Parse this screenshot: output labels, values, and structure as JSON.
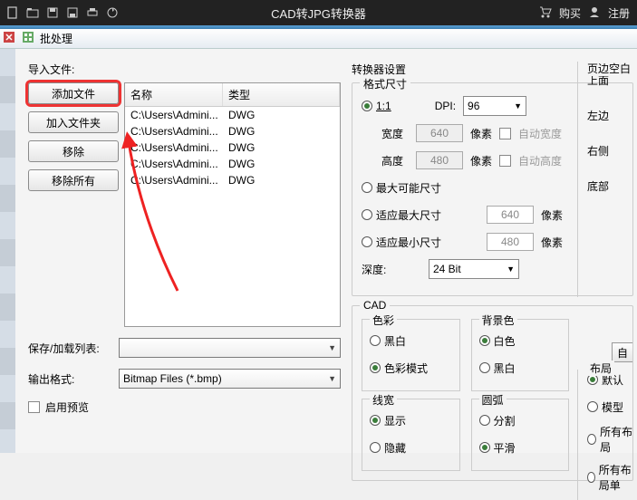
{
  "titlebar": {
    "title": "CAD转JPG转换器",
    "buy": "购买",
    "register": "注册"
  },
  "dialog": {
    "title": "批处理"
  },
  "import": {
    "label": "导入文件:",
    "add_file": "添加文件",
    "add_folder": "加入文件夹",
    "remove": "移除",
    "remove_all": "移除所有"
  },
  "table": {
    "col_name": "名称",
    "col_type": "类型",
    "rows": [
      {
        "name": "C:\\Users\\Admini...",
        "type": "DWG"
      },
      {
        "name": "C:\\Users\\Admini...",
        "type": "DWG"
      },
      {
        "name": "C:\\Users\\Admini...",
        "type": "DWG"
      },
      {
        "name": "C:\\Users\\Admini...",
        "type": "DWG"
      },
      {
        "name": "C:\\Users\\Admini...",
        "type": "DWG"
      }
    ]
  },
  "save_list": {
    "label": "保存/加载列表:",
    "value": ""
  },
  "output_format": {
    "label": "输出格式:",
    "value": "Bitmap Files (*.bmp)"
  },
  "preview": {
    "label": "启用预览"
  },
  "settings": {
    "title": "转换器设置",
    "format_size": "格式尺寸",
    "one_to_one": "1:1",
    "dpi_label": "DPI:",
    "dpi_value": "96",
    "width_label": "宽度",
    "width_value": "640",
    "pixel": "像素",
    "auto_width": "自动宽度",
    "height_label": "高度",
    "height_value": "480",
    "auto_height": "自动高度",
    "max_possible": "最大可能尺寸",
    "fit_max": "适应最大尺寸",
    "fit_max_value": "640",
    "fit_min": "适应最小尺寸",
    "fit_min_value": "480",
    "depth_label": "深度:",
    "depth_value": "24 Bit"
  },
  "margins": {
    "title": "页边空白",
    "top": "上面",
    "left": "左边",
    "right": "右侧",
    "bottom": "底部",
    "self_btn": "自"
  },
  "cad": {
    "title": "CAD",
    "color_title": "色彩",
    "bw": "黑白",
    "color_mode": "色彩模式",
    "bg_title": "背景色",
    "white": "白色",
    "black_bg": "黑白",
    "lw_title": "线宽",
    "show": "显示",
    "hide": "隐藏",
    "arc_title": "圆弧",
    "split": "分割",
    "smooth": "平滑"
  },
  "layout": {
    "title": "布局",
    "default": "默认",
    "model": "模型",
    "all": "所有布局",
    "all_sheets": "所有布局单"
  }
}
